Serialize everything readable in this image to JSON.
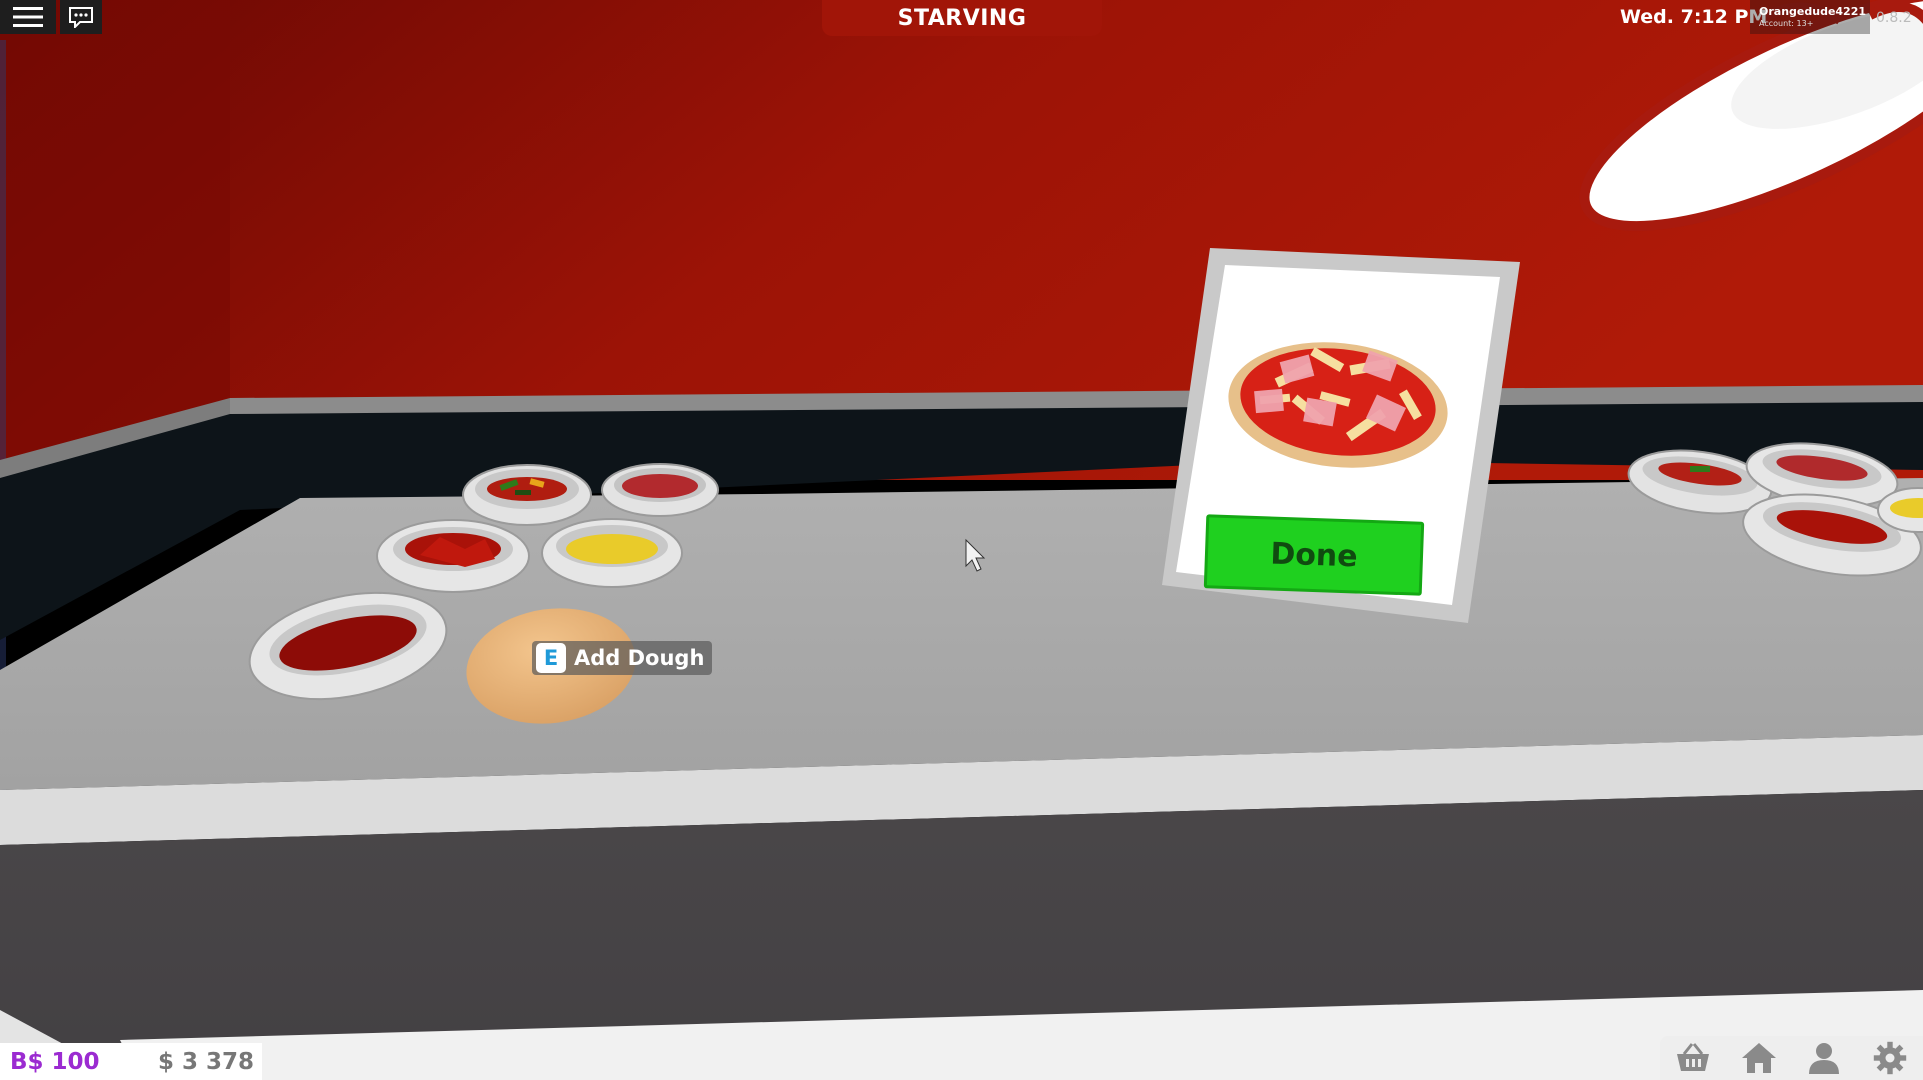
{
  "hud": {
    "status_label": "STARVING",
    "clock": "Wed. 7:12 PM",
    "account_name": "Orangedude4221",
    "account_age": "Account: 13+",
    "version": "0.8.2"
  },
  "interaction_prompt": {
    "key": "E",
    "label": "Add Dough"
  },
  "order_card": {
    "done_label": "Done"
  },
  "currency": {
    "bucks": "B$ 100",
    "cash": "$ 3 378"
  },
  "toolbar": {
    "icons": [
      "shop-basket-icon",
      "home-icon",
      "profile-icon",
      "settings-icon"
    ]
  },
  "colors": {
    "wall_red": "#a01406",
    "done_green": "#1fd01f",
    "bucks_purple": "#9b2bd1"
  }
}
